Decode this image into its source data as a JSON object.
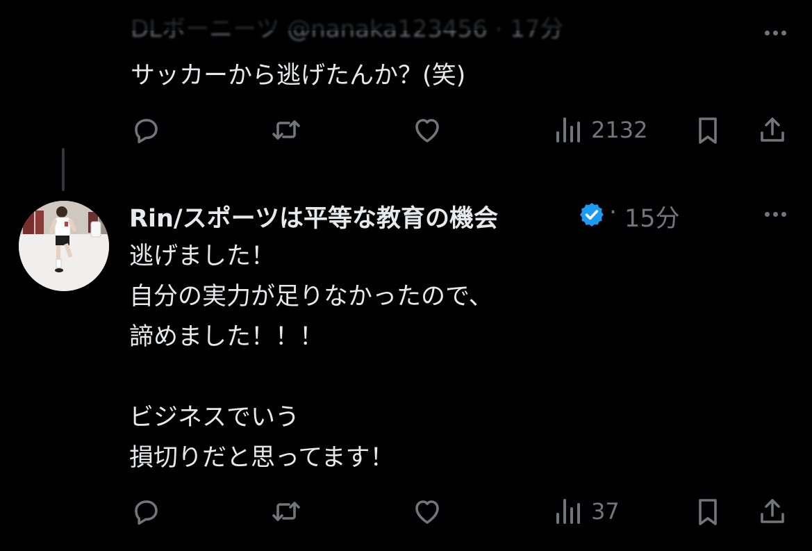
{
  "reply_1": {
    "header_partial": "DLボーニーツ @nanaka123456 · 17分",
    "text": "サッカーから逃げたんか？(笑)",
    "views": "2132"
  },
  "reply_2": {
    "display_name": "Rin/スポーツは平等な教育の機会",
    "separator": "·",
    "time": "15分",
    "text": "逃げました！\n自分の実力が足りなかったので、\n諦めました！！！\n\nビジネスでいう\n損切りだと思ってます！",
    "views": "37"
  },
  "colors": {
    "background": "#000000",
    "text": "#e7e9ea",
    "muted": "#71767b",
    "verified": "#1d9bf0"
  },
  "icons": [
    "reply-icon",
    "repost-icon",
    "like-icon",
    "views-icon",
    "bookmark-icon",
    "share-icon",
    "more-icon",
    "verified-badge-icon"
  ]
}
